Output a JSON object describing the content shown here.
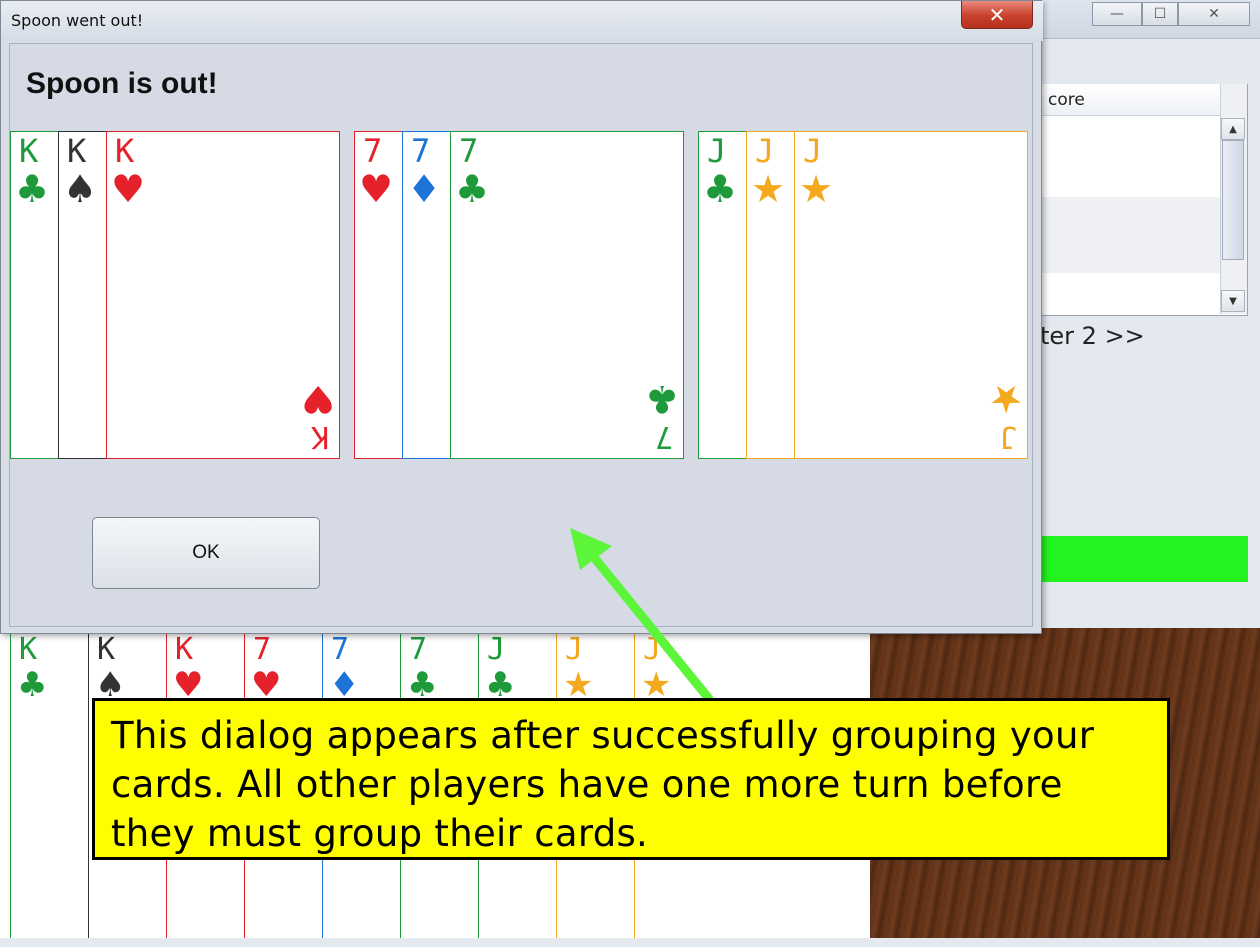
{
  "dialog": {
    "title": "Spoon went out!",
    "close_glyph": "✕",
    "heading": "Spoon is out!",
    "ok_label": "OK"
  },
  "main_window": {
    "minimize_glyph": "—",
    "maximize_glyph": "☐",
    "close_glyph": "✕",
    "score_header": "core",
    "next_player_text": "ter 2 >>"
  },
  "melds": [
    {
      "name": "kings",
      "cards": [
        {
          "rank": "K",
          "suit": "♣",
          "color": "#1e9a3b"
        },
        {
          "rank": "K",
          "suit": "♠",
          "color": "#333333"
        },
        {
          "rank": "K",
          "suit": "♥",
          "color": "#e5212b"
        }
      ]
    },
    {
      "name": "sevens",
      "cards": [
        {
          "rank": "7",
          "suit": "♥",
          "color": "#e5212b"
        },
        {
          "rank": "7",
          "suit": "♦",
          "color": "#1e73d6"
        },
        {
          "rank": "7",
          "suit": "♣",
          "color": "#1e9a3b"
        }
      ]
    },
    {
      "name": "jacks",
      "cards": [
        {
          "rank": "J",
          "suit": "♣",
          "color": "#1e9a3b"
        },
        {
          "rank": "J",
          "suit": "★",
          "color": "#f4a81e"
        },
        {
          "rank": "J",
          "suit": "★",
          "color": "#f4a81e"
        }
      ]
    }
  ],
  "hand": [
    {
      "rank": "K",
      "suit": "♣",
      "color": "#1e9a3b"
    },
    {
      "rank": "K",
      "suit": "♠",
      "color": "#333333"
    },
    {
      "rank": "K",
      "suit": "♥",
      "color": "#e5212b"
    },
    {
      "rank": "7",
      "suit": "♥",
      "color": "#e5212b"
    },
    {
      "rank": "7",
      "suit": "♦",
      "color": "#1e73d6"
    },
    {
      "rank": "7",
      "suit": "♣",
      "color": "#1e9a3b"
    },
    {
      "rank": "J",
      "suit": "♣",
      "color": "#1e9a3b"
    },
    {
      "rank": "J",
      "suit": "★",
      "color": "#f4a81e"
    },
    {
      "rank": "J",
      "suit": "★",
      "color": "#f4a81e"
    }
  ],
  "callout": {
    "text": "This dialog appears after successfully grouping your cards. All other players have one more turn before they must group their cards."
  },
  "colors": {
    "callout_bg": "#fefe00",
    "arrow": "#5cf53a",
    "status_bar": "#22f41f"
  }
}
